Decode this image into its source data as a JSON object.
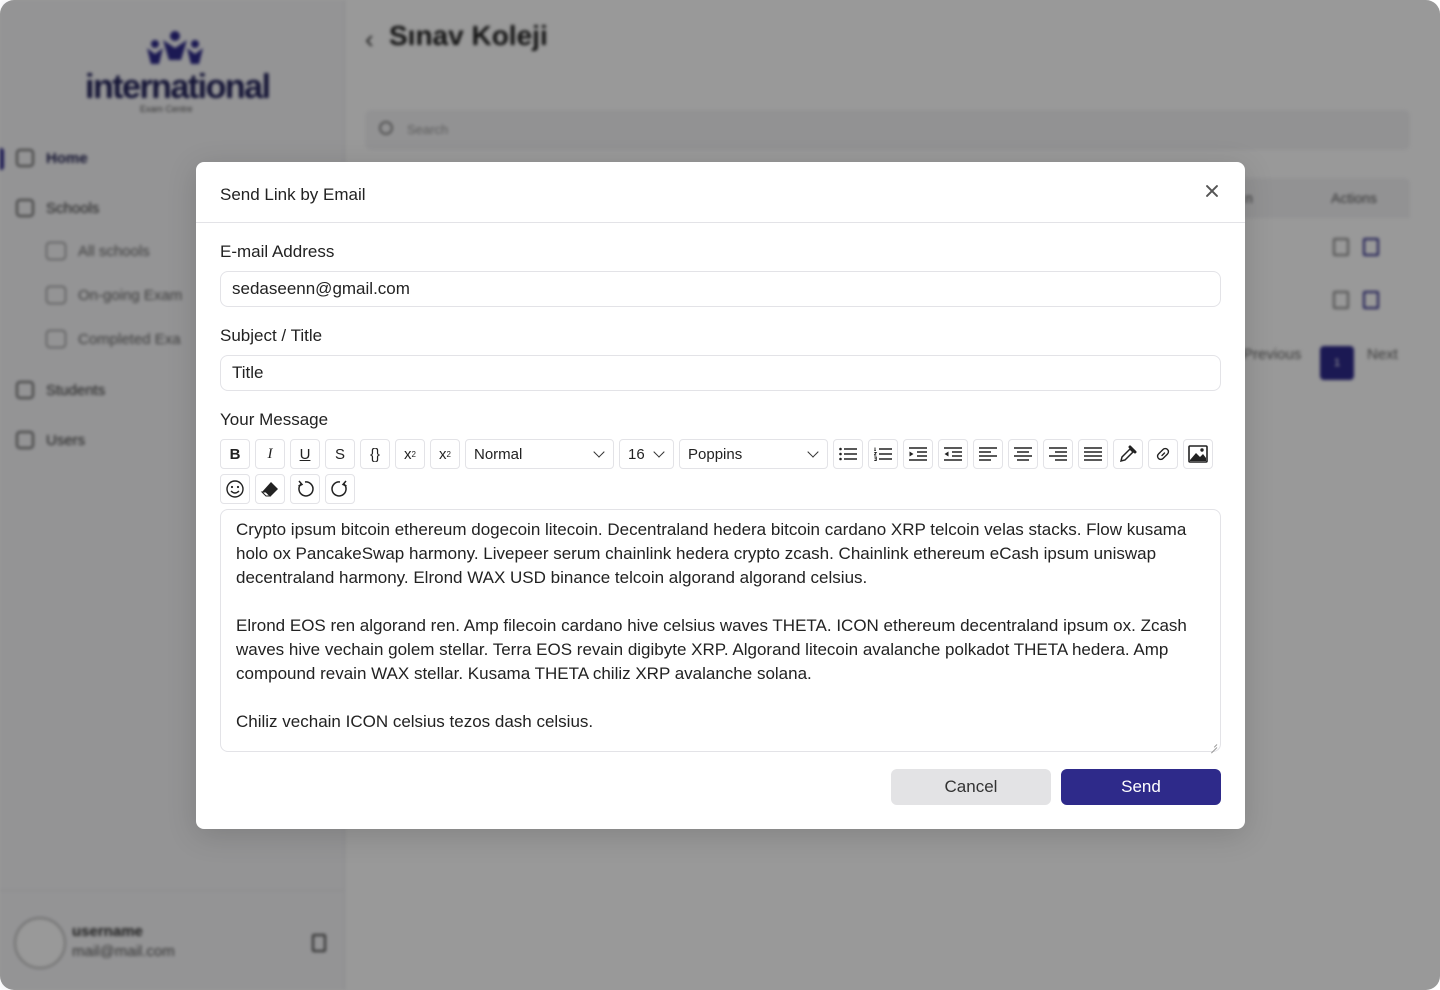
{
  "background": {
    "logo": {
      "word": "international",
      "subtitle": "Exam Centre"
    },
    "nav": {
      "home": "Home",
      "schools": "Schools",
      "all_schools": "All schools",
      "ongoing_exams": "On-going Exam",
      "completed_exams": "Completed Exa",
      "students": "Students",
      "users": "Users"
    },
    "user": {
      "name": "username",
      "email": "mail@mail.com"
    },
    "page_title": "Sınav Koleji",
    "search_placeholder": "Search",
    "table": {
      "actions_header": "Actions",
      "partial_header": "n"
    },
    "pagination": {
      "previous": "Previous",
      "current": "1",
      "next": "Next"
    }
  },
  "modal": {
    "title": "Send Link by Email",
    "email": {
      "label": "E-mail Address",
      "value": "sedaseenn@gmail.com"
    },
    "subject": {
      "label": "Subject / Title",
      "value": "Title"
    },
    "message": {
      "label": "Your Message",
      "paragraphs": [
        "Crypto ipsum bitcoin ethereum dogecoin litecoin. Decentraland hedera bitcoin cardano XRP telcoin velas stacks. Flow kusama holo ox PancakeSwap harmony. Livepeer serum chainlink hedera crypto zcash. Chainlink ethereum eCash ipsum uniswap decentraland harmony. Elrond WAX USD binance telcoin algorand algorand celsius.",
        "Elrond EOS ren algorand ren. Amp filecoin cardano hive celsius waves THETA. ICON ethereum decentraland ipsum ox. Zcash waves hive vechain golem stellar. Terra EOS revain digibyte XRP. Algorand litecoin avalanche polkadot THETA hedera. Amp compound revain WAX stellar. Kusama THETA chiliz XRP avalanche solana.",
        "Chiliz vechain ICON celsius tezos dash celsius."
      ]
    },
    "toolbar": {
      "bold": "B",
      "italic": "I",
      "underline": "U",
      "strike": "S",
      "code": "{}",
      "superscript": "x",
      "subscript": "x",
      "format_value": "Normal",
      "size_value": "16",
      "font_value": "Poppins"
    },
    "buttons": {
      "cancel": "Cancel",
      "send": "Send"
    }
  },
  "colors": {
    "primary": "#2e2a8a",
    "overlay": "rgba(0,0,0,0.40)",
    "cancel_bg": "#e3e3e5"
  }
}
